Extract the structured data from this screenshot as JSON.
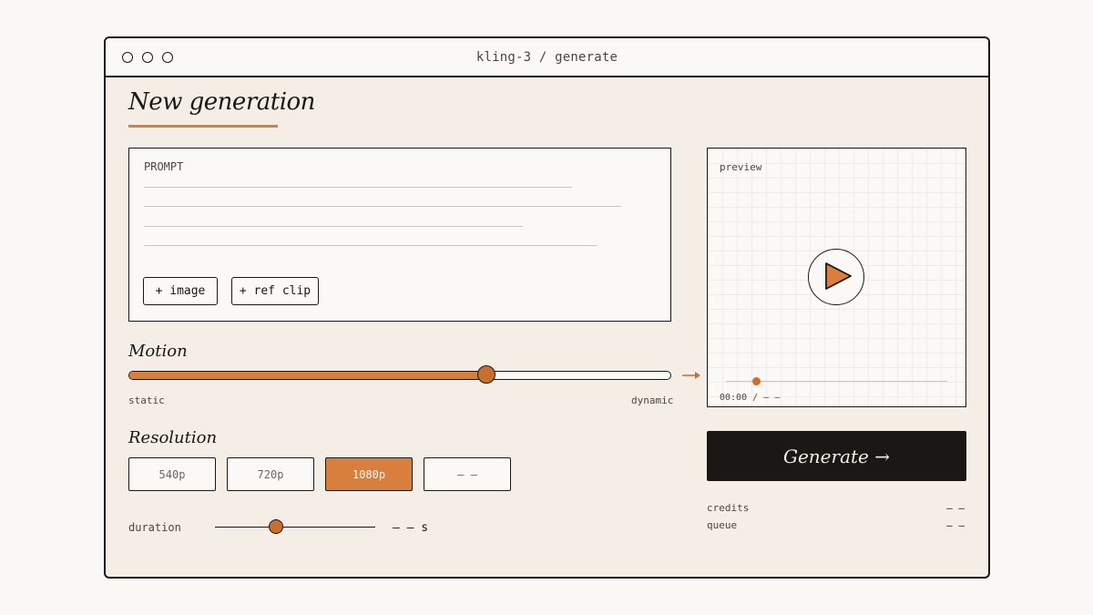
{
  "window": {
    "title": "kling-3 / generate"
  },
  "heading": "New generation",
  "prompt": {
    "label": "PROMPT",
    "value": "",
    "add_image_label": "+ image",
    "add_ref_clip_label": "+ ref clip"
  },
  "motion": {
    "label": "Motion",
    "min_label": "static",
    "max_label": "dynamic",
    "level": 0.66
  },
  "resolution": {
    "label": "Resolution",
    "options": [
      "540p",
      "720p",
      "1080p",
      "– –"
    ],
    "selected": "1080p"
  },
  "duration": {
    "label": "duration",
    "value": "– – s",
    "level": 0.38
  },
  "preview": {
    "label": "preview",
    "timecode": "00:00 / – –"
  },
  "generate": {
    "label": "Generate →"
  },
  "meta": {
    "credits_label": "credits",
    "credits_value": "– –",
    "queue_label": "queue",
    "queue_value": "– –"
  },
  "colors": {
    "accent": "#d97f3d",
    "ink": "#1a1714",
    "panel": "#f4eee6",
    "paper": "#fbf9f6"
  },
  "icons": {
    "window_controls": "circle-icon",
    "play": "play-icon",
    "arrow": "arrow-right-icon"
  }
}
